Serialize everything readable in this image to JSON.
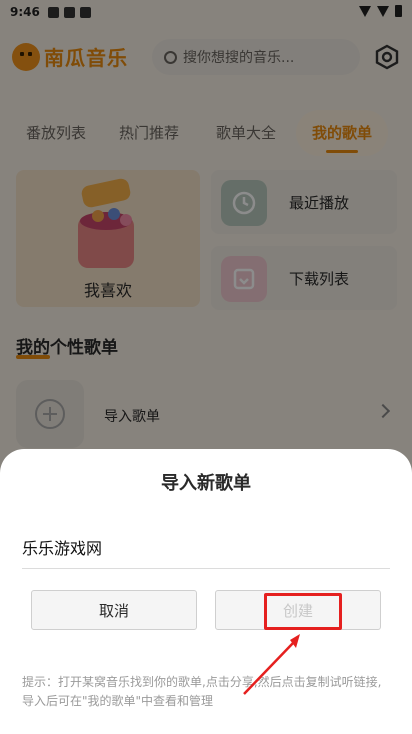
{
  "status": {
    "time": "9:46"
  },
  "header": {
    "logo_text": "南瓜音乐",
    "search_placeholder": "搜你想搜的音乐..."
  },
  "tabs": [
    {
      "label": "番放列表"
    },
    {
      "label": "热门推荐"
    },
    {
      "label": "歌单大全"
    },
    {
      "label": "我的歌单"
    }
  ],
  "active_tab": "我的歌单",
  "cards": {
    "favorite": "我喜欢",
    "recent": "最近播放",
    "download": "下载列表"
  },
  "section": {
    "title": "我的个性歌单"
  },
  "import_row": {
    "label": "导入歌单"
  },
  "dialog": {
    "title": "导入新歌单",
    "input_value": "乐乐游戏网",
    "cancel_label": "取消",
    "create_label": "创建",
    "hint": "提示：打开某窝音乐找到你的歌单,点击分享,然后点击复制试听链接, 导入后可在\"我的歌单\"中查看和管理"
  },
  "colors": {
    "accent": "#e98b0f",
    "highlight": "#e5201f"
  }
}
